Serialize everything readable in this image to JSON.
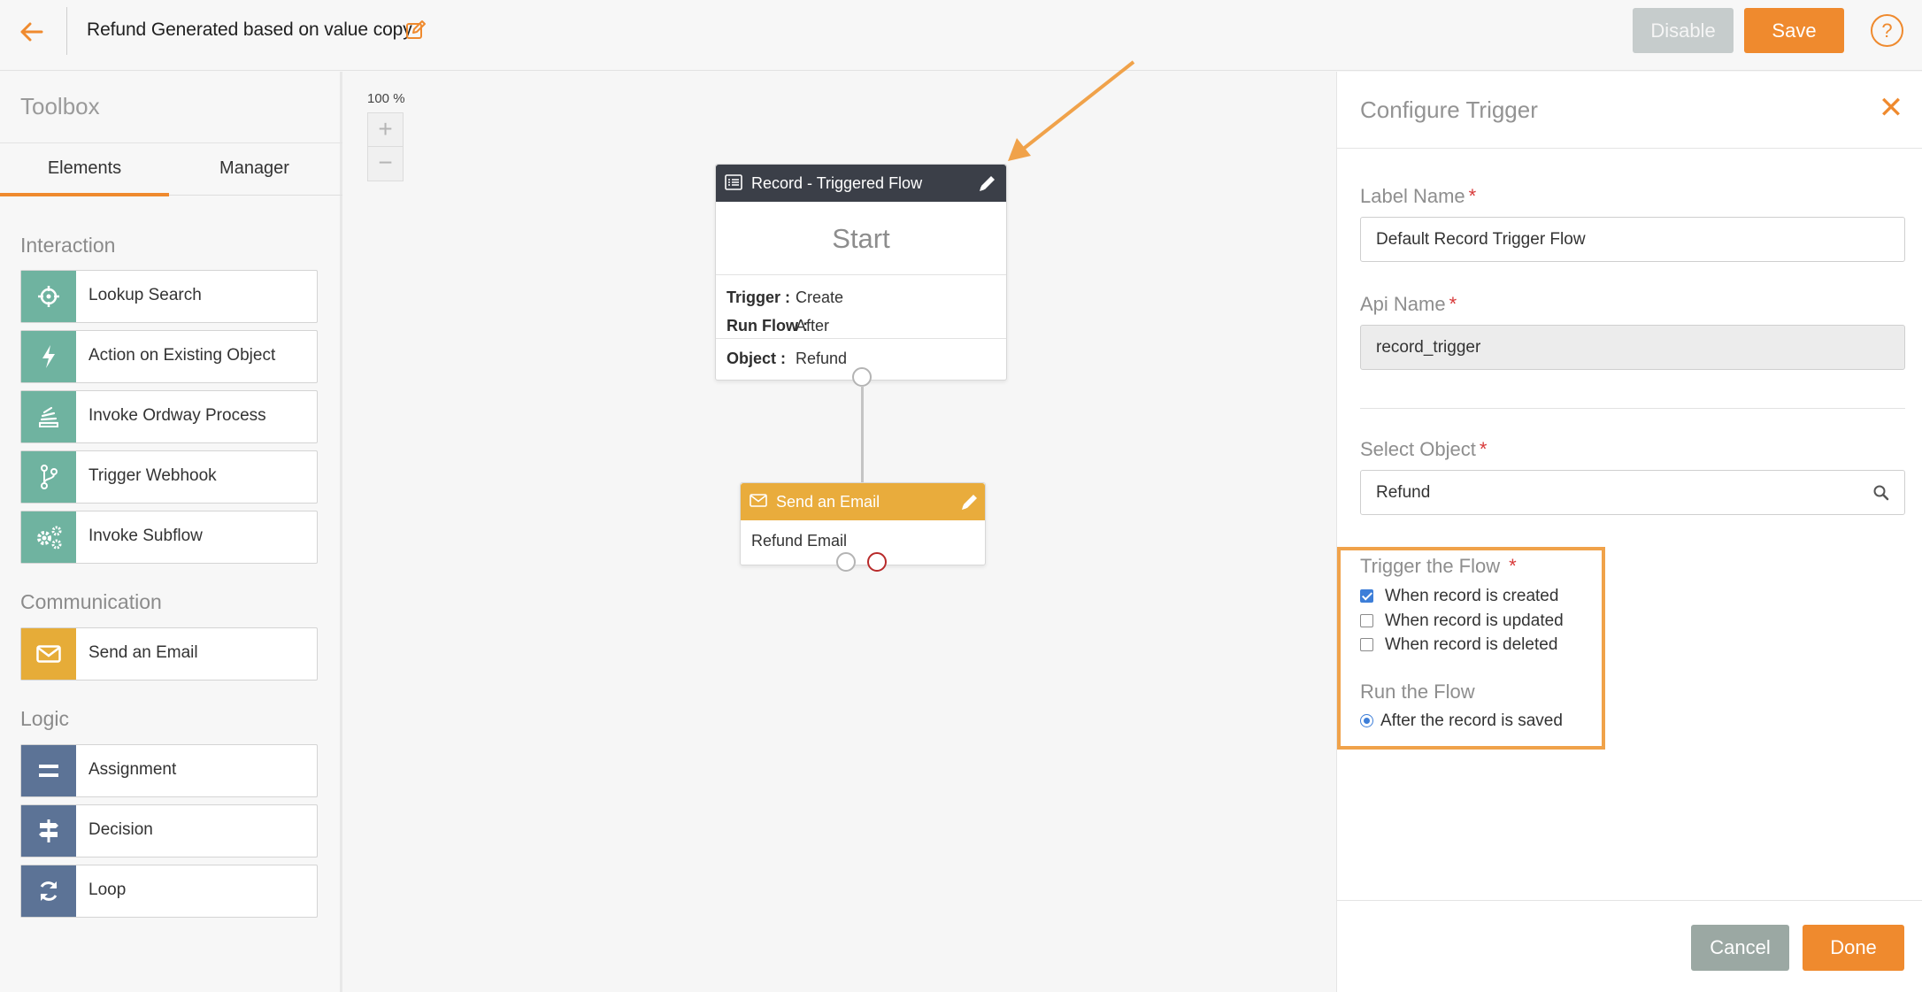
{
  "header": {
    "flow_title": "Refund Generated based on value copy",
    "disable_label": "Disable",
    "save_label": "Save",
    "help_label": "?"
  },
  "toolbox": {
    "title": "Toolbox",
    "tabs": [
      {
        "label": "Elements",
        "active": true
      },
      {
        "label": "Manager",
        "active": false
      }
    ],
    "sections": [
      {
        "title": "Interaction",
        "items": [
          {
            "label": "Lookup Search",
            "icon": "crosshair-icon"
          },
          {
            "label": "Action on Existing Object",
            "icon": "lightning-icon"
          },
          {
            "label": "Invoke Ordway Process",
            "icon": "stack-icon"
          },
          {
            "label": "Trigger Webhook",
            "icon": "branch-icon"
          },
          {
            "label": "Invoke Subflow",
            "icon": "gears-icon"
          }
        ]
      },
      {
        "title": "Communication",
        "items": [
          {
            "label": "Send an Email",
            "icon": "envelope-icon"
          }
        ]
      },
      {
        "title": "Logic",
        "items": [
          {
            "label": "Assignment",
            "icon": "equals-icon"
          },
          {
            "label": "Decision",
            "icon": "signpost-icon"
          },
          {
            "label": "Loop",
            "icon": "refresh-icon"
          }
        ]
      }
    ]
  },
  "canvas": {
    "zoom_level": "100 %",
    "zoom_in": "+",
    "zoom_out": "−",
    "start_node": {
      "title": "Record - Triggered Flow",
      "label": "Start",
      "trigger_key": "Trigger :",
      "trigger_value": "Create",
      "run_key": "Run Flow :",
      "run_value": "After",
      "object_key": "Object :",
      "object_value": "Refund"
    },
    "email_node": {
      "title": "Send an Email",
      "body": "Refund Email"
    }
  },
  "panel": {
    "title": "Configure Trigger",
    "close_label": "✕",
    "label_name": {
      "label": "Label Name",
      "value": "Default Record Trigger Flow"
    },
    "api_name": {
      "label": "Api Name",
      "value": "record_trigger"
    },
    "select_object": {
      "label": "Select Object",
      "value": "Refund"
    },
    "required_mark": "*",
    "trigger_flow": {
      "title": "Trigger the Flow",
      "options": [
        {
          "label": "When record is created",
          "checked": true
        },
        {
          "label": "When record is updated",
          "checked": false
        },
        {
          "label": "When record is deleted",
          "checked": false
        }
      ]
    },
    "run_flow": {
      "title": "Run the Flow",
      "option": "After the record is saved"
    },
    "cancel_label": "Cancel",
    "done_label": "Done"
  },
  "colors": {
    "accent": "#ef8a2e",
    "teal": "#6fb3a0",
    "gold": "#e6ac38",
    "slate": "#5c7396",
    "dark_header": "#3b3f48",
    "highlight_border": "#f0a24a"
  }
}
